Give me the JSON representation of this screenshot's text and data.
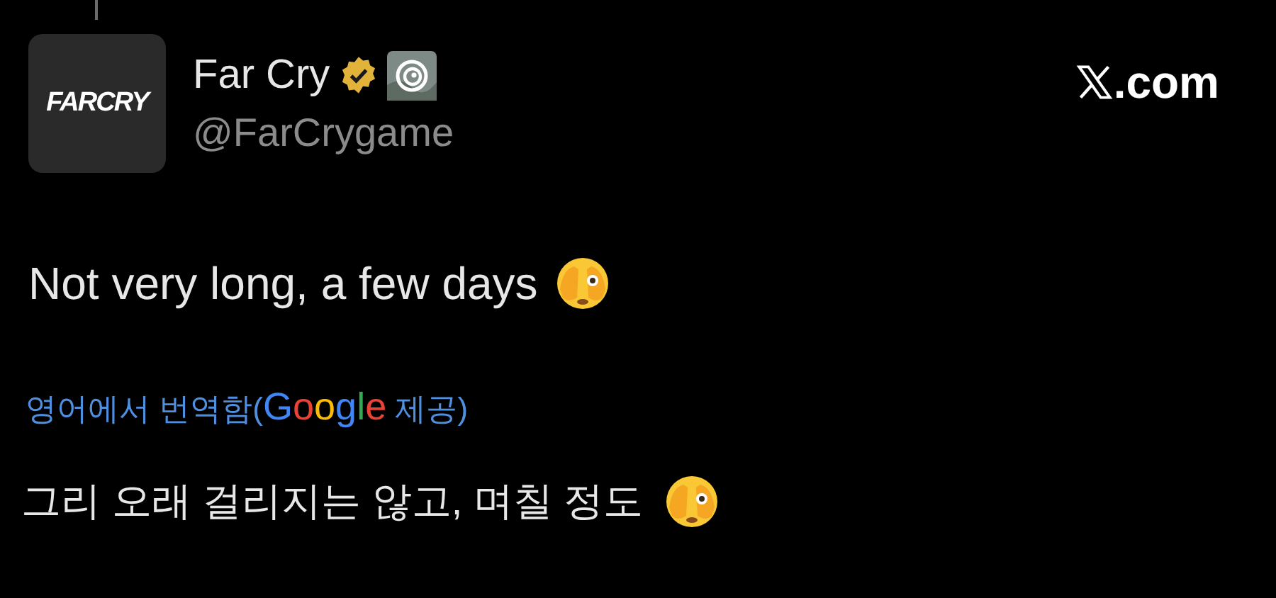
{
  "author": {
    "avatar_text": "FARCRY",
    "name": "Far Cry",
    "verified": true,
    "handle": "@FarCrygame"
  },
  "site": {
    "domain": ".com"
  },
  "tweet": {
    "text": "Not very long, a few days"
  },
  "translation": {
    "prefix": "영어에서 번역함(",
    "provider": "Google",
    "suffix": " 제공)",
    "text": "그리 오래 걸리지는 않고, 며칠 정도"
  }
}
